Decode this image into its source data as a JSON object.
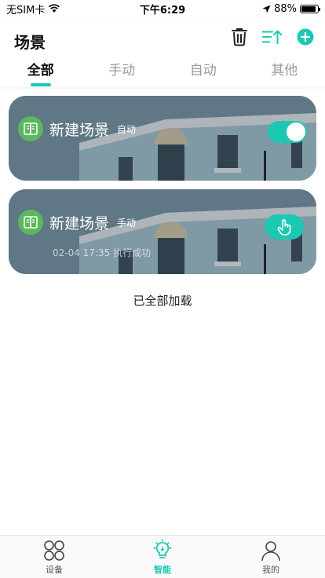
{
  "status_bar": {
    "carrier": "无SIM卡",
    "time": "下午6:29",
    "battery": "88%",
    "battery_level": 0.88
  },
  "header": {
    "title": "场景"
  },
  "tabs": [
    {
      "label": "全部",
      "active": true
    },
    {
      "label": "手动",
      "active": false
    },
    {
      "label": "自动",
      "active": false
    },
    {
      "label": "其他",
      "active": false
    }
  ],
  "scenes": [
    {
      "name": "新建场景",
      "mode": "自动",
      "enabled": true
    },
    {
      "name": "新建场景",
      "mode": "手动",
      "status": "02-04 17:35 执行成功"
    }
  ],
  "list": {
    "load_status": "已全部加载"
  },
  "bottom_nav": [
    {
      "label": "设备",
      "icon": "device-grid-icon"
    },
    {
      "label": "智能",
      "icon": "lightbulb-icon",
      "active": true
    },
    {
      "label": "我的",
      "icon": "person-icon"
    }
  ],
  "colors": {
    "accent": "#1cc8b2",
    "scene_icon": "#5bb85c"
  }
}
